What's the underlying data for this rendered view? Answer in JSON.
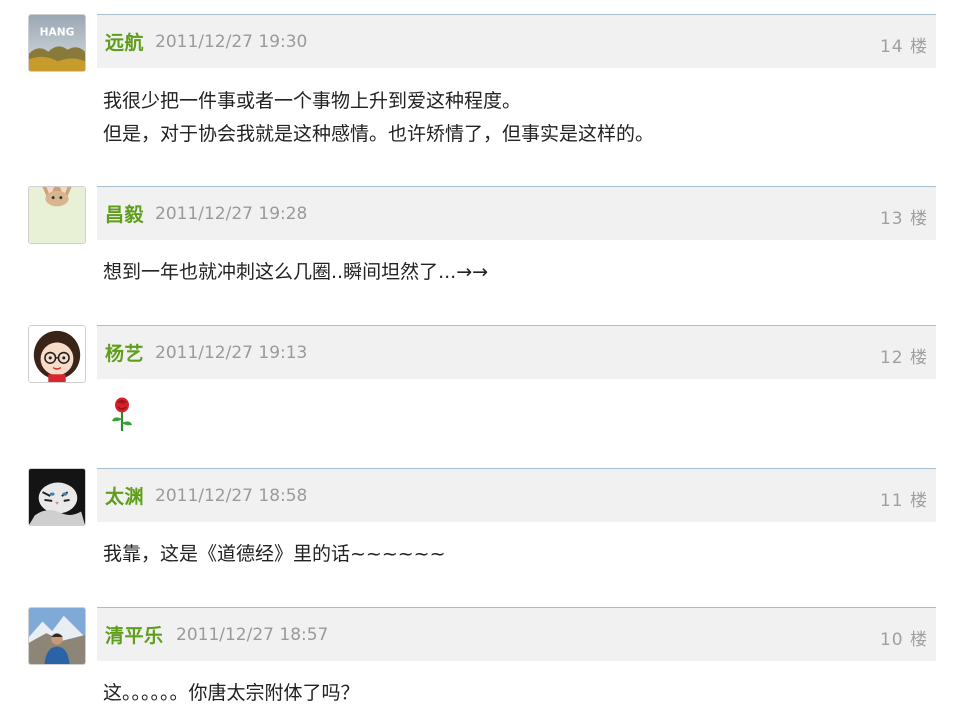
{
  "posts": [
    {
      "username": "远航",
      "timestamp": "2011/12/27 19:30",
      "floor": "14 楼",
      "avatar_icon": "landscape-avatar-icon",
      "avatar_text": "HANG",
      "lines": [
        "我很少把一件事或者一个事物上升到爱这种程度。",
        "但是，对于协会我就是这种感情。也许矫情了，但事实是这样的。"
      ]
    },
    {
      "username": "昌毅",
      "timestamp": "2011/12/27 19:28",
      "floor": "13 楼",
      "avatar_icon": "cartoon-cat-avatar-icon",
      "lines": [
        "想到一年也就冲刺这么几圈..瞬间坦然了...→→"
      ]
    },
    {
      "username": "杨艺",
      "timestamp": "2011/12/27 19:13",
      "floor": "12 楼",
      "avatar_icon": "cartoon-girl-glasses-avatar-icon",
      "lines": [],
      "content_icon": "rose-emoji-icon"
    },
    {
      "username": "太渊",
      "timestamp": "2011/12/27 18:58",
      "floor": "11 楼",
      "avatar_icon": "white-tiger-avatar-icon",
      "lines": [
        "我靠，这是《道德经》里的话~~~~~~"
      ]
    },
    {
      "username": "清平乐",
      "timestamp": "2011/12/27 18:57",
      "floor": "10 楼",
      "avatar_icon": "mountain-person-avatar-icon",
      "lines": [
        "这。。。。。。你唐太宗附体了吗？"
      ]
    }
  ],
  "colors": {
    "username": "#5f9e1a",
    "header_bg": "#f1f1f1",
    "header_border": "#a9bfd0",
    "meta_text": "#9a9a9a"
  }
}
